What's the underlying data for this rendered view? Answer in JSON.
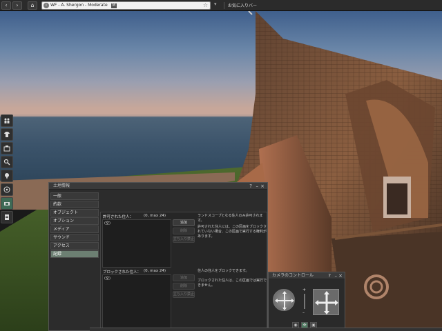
{
  "topbar": {
    "back_icon": "back-arrow-icon",
    "forward_icon": "forward-arrow-icon",
    "home_icon": "home-icon",
    "location": "WF - A. Shergon - Moderate",
    "maturity_badge": "M",
    "favorites_label": "お気に入りバー"
  },
  "left_toolbar": {
    "items": [
      "people-icon",
      "appearance-icon",
      "inventory-icon",
      "search-icon",
      "places-icon",
      "minimap-icon",
      "land-icon",
      "notes-icon"
    ],
    "active_index": 6
  },
  "land_dialog": {
    "title": "土地情報",
    "help": "?",
    "minimize": "–",
    "close": "×",
    "tabs": [
      "一般",
      "約款",
      "オブジェクト",
      "オプション",
      "メディア",
      "サウンド",
      "アクセス",
      "記録"
    ],
    "active_tab": 7,
    "allowed": {
      "header": "許可された住人：",
      "max": "(0, max 24)",
      "row": "(空)",
      "add": "追加",
      "remove": "削除",
      "ban": "立ち入り禁止"
    },
    "banned": {
      "header": "ブロックされた住人：",
      "max": "(0, max 24)",
      "row": "(空)",
      "add": "追加",
      "remove": "削除",
      "ban": "立ち入り禁止"
    },
    "allowed_info_1": "ランドスコープとなる住人のみ許可されます。",
    "allowed_info_2": "許可された住人には、この区画をブロックされていない場合、この区画で実行する権利があります。",
    "banned_info_1": "住人の住人をブロックできます。",
    "banned_info_2": "ブロックされた住人は、この区画では実行できません。"
  },
  "camera": {
    "title": "カメラのコントロール",
    "help": "?",
    "minimize": "–",
    "close": "×",
    "orbit_icon": "orbit-icon",
    "pan_icon": "pan-icon",
    "zoom_plus": "+",
    "zoom_minus": "–",
    "modes": [
      "eye-icon",
      "object-view-icon",
      "camera-preset-icon"
    ]
  },
  "colors": {
    "accent": "#4e7a60",
    "active_tab": "#6c7f72"
  }
}
